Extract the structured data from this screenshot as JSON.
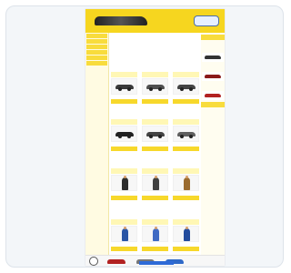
{
  "brand": {
    "name": "",
    "tagline": "",
    "badge": ""
  },
  "left_sidebar": {
    "items": [
      {
        "label": ""
      },
      {
        "label": ""
      },
      {
        "label": ""
      },
      {
        "label": ""
      },
      {
        "label": ""
      },
      {
        "label": ""
      }
    ]
  },
  "main": {
    "breadcrumb": "",
    "section_title": "",
    "intro": ""
  },
  "products": [
    {
      "title": "",
      "price": "",
      "button": "",
      "kind": "car",
      "color": "#3b3b3b"
    },
    {
      "title": "",
      "price": "",
      "button": "",
      "kind": "car",
      "color": "#505050"
    },
    {
      "title": "",
      "price": "",
      "button": "",
      "kind": "car",
      "color": "#444444"
    },
    {
      "title": "",
      "price": "",
      "button": "",
      "kind": "car",
      "color": "#222222"
    },
    {
      "title": "",
      "price": "",
      "button": "",
      "kind": "car",
      "color": "#444444"
    },
    {
      "title": "",
      "price": "",
      "button": "",
      "kind": "car",
      "color": "#606060"
    },
    {
      "title": "",
      "price": "",
      "button": "",
      "kind": "figure",
      "color": "#2d2d2d"
    },
    {
      "title": "",
      "price": "",
      "button": "",
      "kind": "figure",
      "color": "#404040"
    },
    {
      "title": "",
      "price": "",
      "button": "",
      "kind": "figure",
      "color": "#9a6b2f"
    },
    {
      "title": "",
      "price": "",
      "button": "",
      "kind": "figure",
      "color": "#2b56a5"
    },
    {
      "title": "",
      "price": "",
      "button": "",
      "kind": "figure",
      "color": "#3f6ac3"
    },
    {
      "title": "",
      "price": "",
      "button": "",
      "kind": "figure",
      "color": "#234c9d"
    }
  ],
  "right_sidebar": {
    "header": "",
    "lines": [
      "",
      "",
      "",
      "",
      "",
      "",
      "",
      ""
    ],
    "footer_header": ""
  },
  "footer": {
    "link": ""
  }
}
